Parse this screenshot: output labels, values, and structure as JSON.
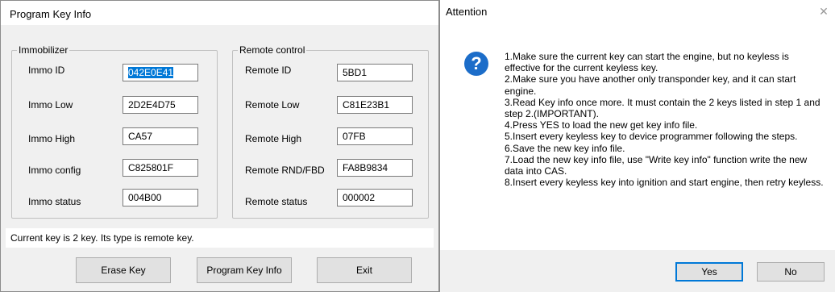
{
  "program_window": {
    "title": "Program Key Info",
    "immobilizer": {
      "legend": "Immobilizer",
      "rows": [
        {
          "label": "Immo ID",
          "value": "042E0E41",
          "selected": true
        },
        {
          "label": "Immo Low",
          "value": "2D2E4D75"
        },
        {
          "label": "Immo High",
          "value": "CA57"
        },
        {
          "label": "Immo config",
          "value": "C825801F"
        },
        {
          "label": "Immo status",
          "value": "004B00"
        }
      ]
    },
    "remote_control": {
      "legend": "Remote control",
      "rows": [
        {
          "label": "Remote ID",
          "value": "5BD1"
        },
        {
          "label": "Remote Low",
          "value": "C81E23B1"
        },
        {
          "label": "Remote High",
          "value": "07FB"
        },
        {
          "label": "Remote RND/FBD",
          "value": "FA8B9834"
        },
        {
          "label": "Remote status",
          "value": "000002"
        }
      ]
    },
    "status_text": "Current key is 2 key. Its type is remote key.",
    "buttons": {
      "erase": "Erase Key",
      "program": "Program Key Info",
      "exit": "Exit"
    }
  },
  "attention_dialog": {
    "title": "Attention",
    "close_glyph": "✕",
    "icon_glyph": "?",
    "message_lines": [
      "1.Make sure the current key can start the engine, but no keyless is effective for the current keyless key.",
      "2.Make sure you have another only transponder key, and it can start engine.",
      "3.Read Key info once more. It must contain the 2 keys listed in step 1 and step 2.(IMPORTANT).",
      "4.Press YES to load the new get key info file.",
      "5.Insert every keyless key to device programmer following the steps.",
      "6.Save the new key info file.",
      "7.Load the new key info file, use \"Write key info\" function write the new data into CAS.",
      "8.Insert every keyless key into ignition and start engine, then retry keyless."
    ],
    "buttons": {
      "yes": "Yes",
      "no": "No"
    }
  }
}
